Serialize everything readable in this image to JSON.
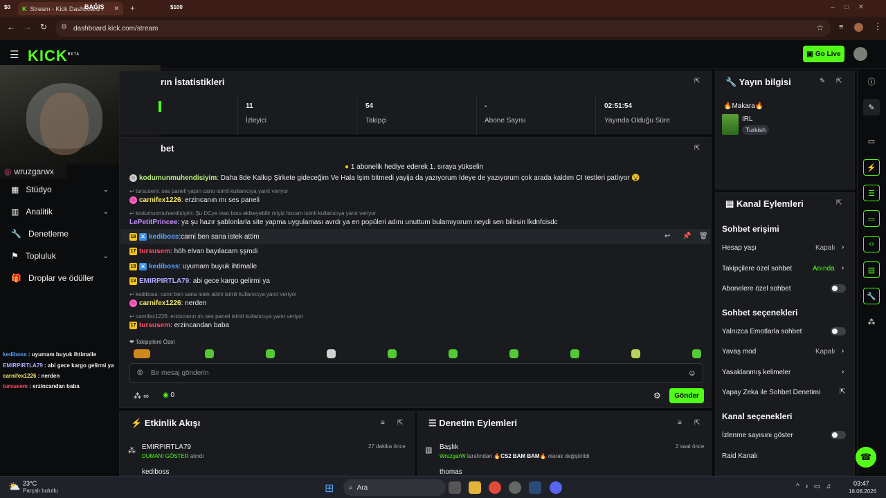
{
  "browser": {
    "tab_price_left": "$0",
    "tab_title": "Stream - Kick Dashboard",
    "tab_badge": "BAĞIŞ",
    "tab_price_right": "$100",
    "url": "dashboard.kick.com/stream"
  },
  "header": {
    "logo": "KICK",
    "beta": "BETA",
    "golive": "Go Live"
  },
  "webcam": {
    "handle": "wruzgarwx"
  },
  "nav": {
    "items": [
      {
        "label": "Stüdyo",
        "chev": "⌄"
      },
      {
        "label": "Analitik",
        "chev": "⌄"
      },
      {
        "label": "Denetleme"
      },
      {
        "label": "Topluluk",
        "chev": "⌄"
      },
      {
        "label": "Droplar ve ödüller"
      }
    ]
  },
  "overlay_chat": [
    {
      "user": "kediboss",
      "text": " : uyumam buyuk ihtimalle",
      "color": "#5aa0ff"
    },
    {
      "user": "EMIRPIRTLA79",
      "text": " : abi gece kargo gelirmi ya",
      "color": "#b1a7ff"
    },
    {
      "user": "carnifex1226",
      "text": " : nerden",
      "color": "#f5e66a"
    },
    {
      "user": "tursusem",
      "text": " : erzincandan baba",
      "color": "#ff4d6a"
    }
  ],
  "stats": {
    "title": "rın İstatistikleri",
    "cells": [
      {
        "value": "11",
        "label": "İzleyici"
      },
      {
        "value": "54",
        "label": "Takipçi"
      },
      {
        "value": "-",
        "label": "Abone Sayısı"
      },
      {
        "value": "02:51:54",
        "label": "Yayında Olduğu Süre"
      }
    ]
  },
  "chat": {
    "title": "bet",
    "banner": "1 abonelik hediye ederek 1. sıraya yükselin",
    "messages": [
      {
        "user": "kodumunmuhendisiyim",
        "text": ": Daha 8de Kalkıp Şirkete gideceğim Ve Hala İşim bitmedi yayija da yazıyorum İdeye de yazıyorum çok arada kaldım CI testleri patlıyor 😵",
        "color": "#b8f07a"
      },
      {
        "reply": "tursusem: ses paneli yapın cano isimli kullanıcıya yanıt veriyor"
      },
      {
        "user": "carnifex1226",
        "text": ": erzincanın mı ses paneli",
        "color": "#f5e66a"
      },
      {
        "reply": "kodumunmuhendisiyim: Şu DCye owo botu eklkeyebilir miyiz hocam isimli kullanıcıya yanıt veriyor"
      },
      {
        "user": "LePetitPrincee",
        "text": ": ya şu hazır şablonlarla site yapma uygulaması avrdı ya en popüleri adını unuttum bulamıyorum neydi sen bilirsin lkdnfcisdc",
        "color": "#c58cff"
      },
      {
        "user": "kediboss",
        "text": ":carni ben sana istek attim",
        "color": "#5aa0ff",
        "badge": "18"
      },
      {
        "user": "tursusem",
        "text": ": höh elvan bayılacam şşmdi",
        "color": "#ff4d6a",
        "badge": "17"
      },
      {
        "user": "kediboss",
        "text": ": uyumam buyuk ihtimalle",
        "color": "#5aa0ff",
        "badge": "18"
      },
      {
        "user": "EMIRPIRTLA79",
        "text": ": abi gece kargo gelirmi ya",
        "color": "#b1a7ff",
        "badge": "13"
      },
      {
        "reply": "kediboss: carni ben sana istek attim isimli kullanıcıya yanıt veriyor"
      },
      {
        "user": "carnifex1226",
        "text": ": nerden",
        "color": "#f5e66a"
      },
      {
        "reply": "carnifex1226: erzincanın mı ses paneli isimli kullanıcıya yanıt veriyor"
      },
      {
        "user": "tursusem",
        "text": ": erzincandan baba",
        "color": "#ff4d6a",
        "badge": "17"
      }
    ],
    "followers_label": "Takipçilere Özel",
    "input_placeholder": "Bir mesaj gönderin",
    "points": "∞",
    "coins": "0",
    "send": "Gönder"
  },
  "activity": {
    "title": "Etkinlik Akışı",
    "items": [
      {
        "user": "EMIRPIRTLA79",
        "time": "27 dakika önce",
        "reward": "DUMANI GÖSTER",
        "suffix": "alındı"
      },
      {
        "user": "kediboss"
      }
    ]
  },
  "moderation": {
    "title": "Denetim Eylemleri",
    "items": [
      {
        "label": "Başlık",
        "time": "2 saat önce",
        "actor": "WruzgarW",
        "mid": "tarafından",
        "value": "CS2 BAM BAM",
        "suffix": "olarak değiştirildi"
      },
      {
        "label": "thomas"
      }
    ]
  },
  "stream_info": {
    "title": "Yayın bilgisi",
    "stream_title": "🔥Makara🔥",
    "category": "IRL",
    "language": "Turkish"
  },
  "channel_actions": {
    "title": "Kanal Eylemleri",
    "chat_access": "Sohbet erişimi",
    "account_age": "Hesap yaşı",
    "account_age_val": "Kapalı",
    "followers_only": "Takipçilere özel sohbet",
    "followers_only_val": "Anında",
    "subs_only": "Abonelere özel sohbet",
    "chat_options": "Sohbet seçenekleri",
    "emotes_only": "Yalnızca Emotlarla sohbet",
    "slow_mode": "Yavaş mod",
    "slow_mode_val": "Kapalı",
    "banned_words": "Yasaklanmış kelimeler",
    "ai_mod": "Yapay Zeka ile Sohbet Denetimi",
    "channel_options": "Kanal seçenekleri",
    "show_views": "İzlenme sayısını göster",
    "raid": "Raid Kanalı"
  },
  "taskbar": {
    "temp": "23°C",
    "weather": "Parçalı bulutlu",
    "search": "Ara",
    "time": "03:47",
    "date": "18.08.2026"
  },
  "colors": {
    "accent": "#53fc18",
    "panel": "#191b1f",
    "bg": "#0b0c0d"
  }
}
